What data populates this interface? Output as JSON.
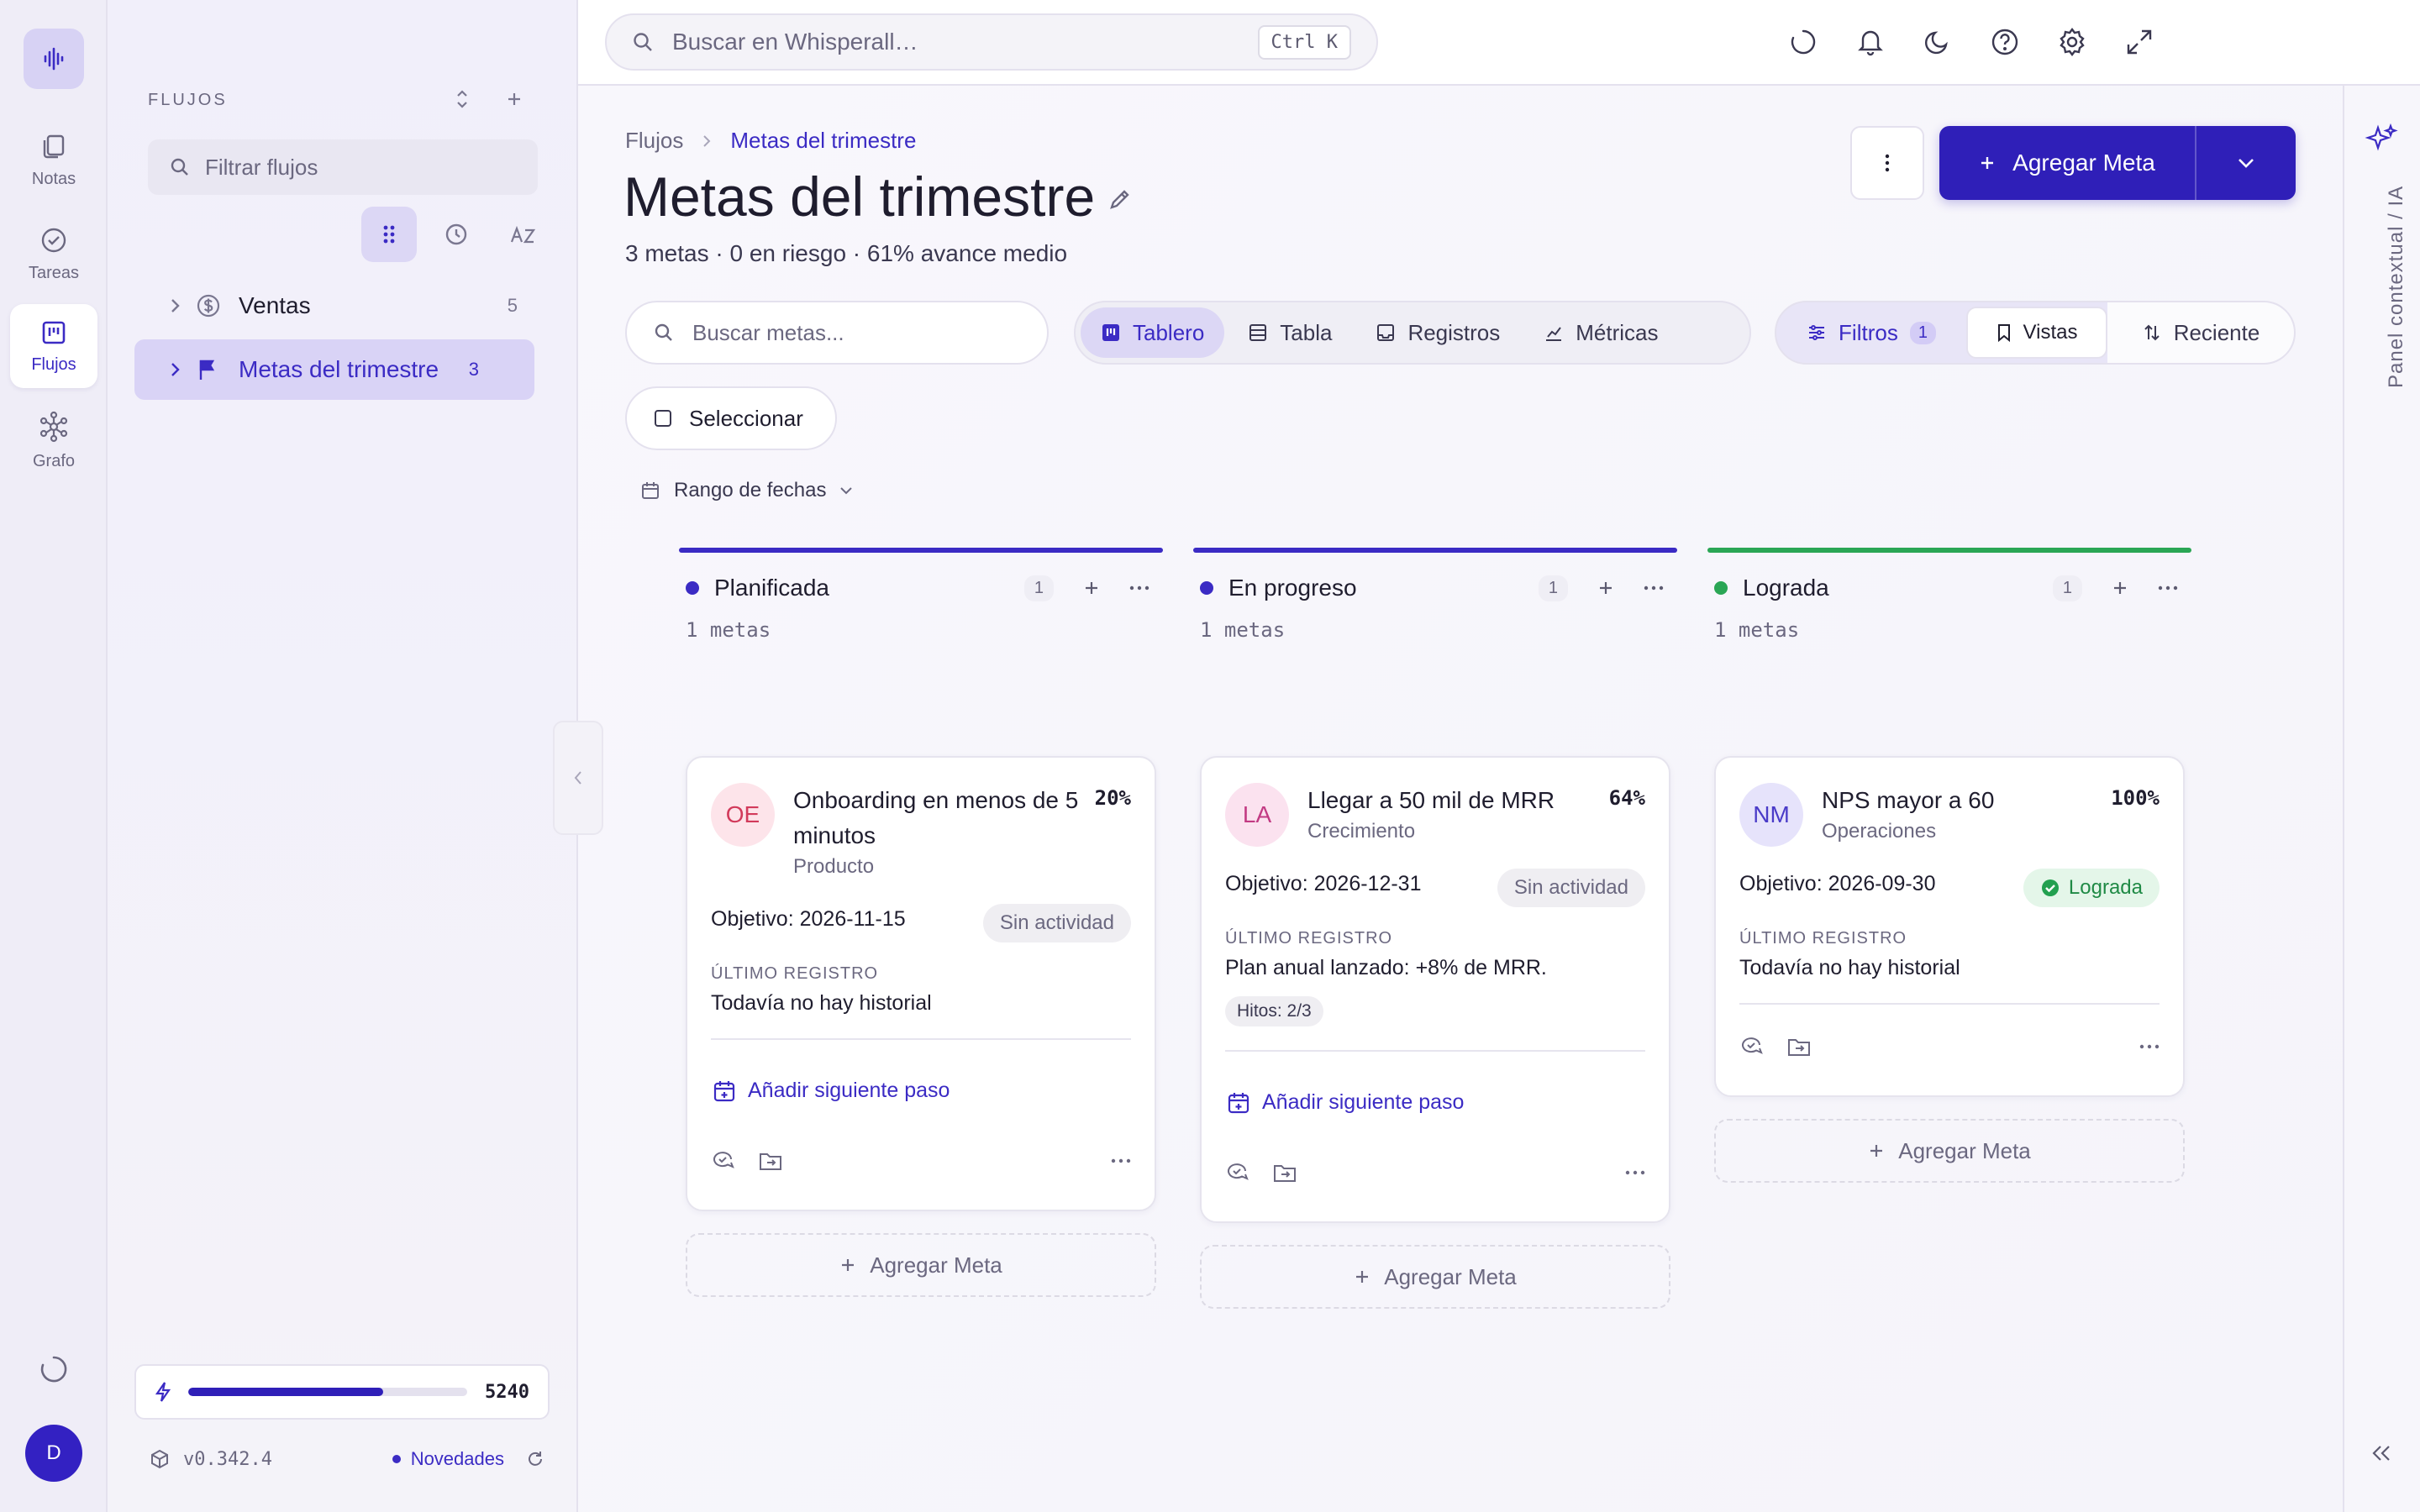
{
  "app": {
    "version": "v0.342.4",
    "news_label": "Novedades",
    "credits": 5240,
    "credits_fraction": 0.7
  },
  "rail": {
    "items": [
      {
        "label": "Notas",
        "icon": "notes-icon"
      },
      {
        "label": "Tareas",
        "icon": "check-circle-icon"
      },
      {
        "label": "Flujos",
        "icon": "board-icon",
        "active": true
      },
      {
        "label": "Grafo",
        "icon": "graph-icon"
      }
    ],
    "avatar_initial": "D"
  },
  "sidebar": {
    "title": "FLUJOS",
    "filter_placeholder": "Filtrar flujos",
    "flows": [
      {
        "name": "Ventas",
        "count": "5",
        "icon": "dollar-icon"
      },
      {
        "name": "Metas del trimestre",
        "count": "3",
        "icon": "flag-icon",
        "active": true
      }
    ]
  },
  "topbar": {
    "search_placeholder": "Buscar en Whisperall…",
    "shortcut": "Ctrl K"
  },
  "header": {
    "breadcrumb_root": "Flujos",
    "breadcrumb_current": "Metas del trimestre",
    "title": "Metas del trimestre",
    "subtitle": "3 metas · 0 en riesgo · 61% avance medio",
    "add_label": "Agregar Meta"
  },
  "toolbar": {
    "search_placeholder": "Buscar metas...",
    "tabs": [
      "Tablero",
      "Tabla",
      "Registros",
      "Métricas"
    ],
    "active_tab": "Tablero",
    "filters_label": "Filtros",
    "filters_count": "1",
    "views_label": "Vistas",
    "sort_label": "Reciente",
    "select_label": "Seleccionar",
    "date_range_label": "Rango de fechas"
  },
  "columns": [
    {
      "name": "Planificada",
      "count": "1",
      "sub": "1 metas",
      "color": "#3b2bc4",
      "card": {
        "initials": "OE",
        "avatar_bg": "#fde4ea",
        "avatar_fg": "#d23a5b",
        "title": "Onboarding en menos de 5 minutos",
        "area": "Producto",
        "pct": "20%",
        "objective": "Objetivo: 2026-11-15",
        "status": "Sin actividad",
        "log_label": "ÚLTIMO REGISTRO",
        "log": "Todavía no hay historial",
        "next_step": "Añadir siguiente paso"
      }
    },
    {
      "name": "En progreso",
      "count": "1",
      "sub": "1 metas",
      "color": "#3b2bc4",
      "card": {
        "initials": "LA",
        "avatar_bg": "#fbe2ef",
        "avatar_fg": "#c23a83",
        "title": "Llegar a 50 mil de MRR",
        "area": "Crecimiento",
        "pct": "64%",
        "objective": "Objetivo: 2026-12-31",
        "status": "Sin actividad",
        "log_label": "ÚLTIMO REGISTRO",
        "log": "Plan anual lanzado: +8% de MRR.",
        "chip": "Hitos: 2/3",
        "next_step": "Añadir siguiente paso"
      }
    },
    {
      "name": "Lograda",
      "count": "1",
      "sub": "1 metas",
      "color": "#2aa655",
      "card": {
        "initials": "NM",
        "avatar_bg": "#e6e3fb",
        "avatar_fg": "#4a3bc8",
        "title": "NPS mayor a 60",
        "area": "Operaciones",
        "pct": "100%",
        "objective": "Objetivo: 2026-09-30",
        "status": "Lograda",
        "log_label": "ÚLTIMO REGISTRO",
        "log": "Todavía no hay historial"
      }
    }
  ],
  "add_meta_label": "Agregar Meta",
  "right_panel": {
    "label": "Panel contextual / IA"
  }
}
